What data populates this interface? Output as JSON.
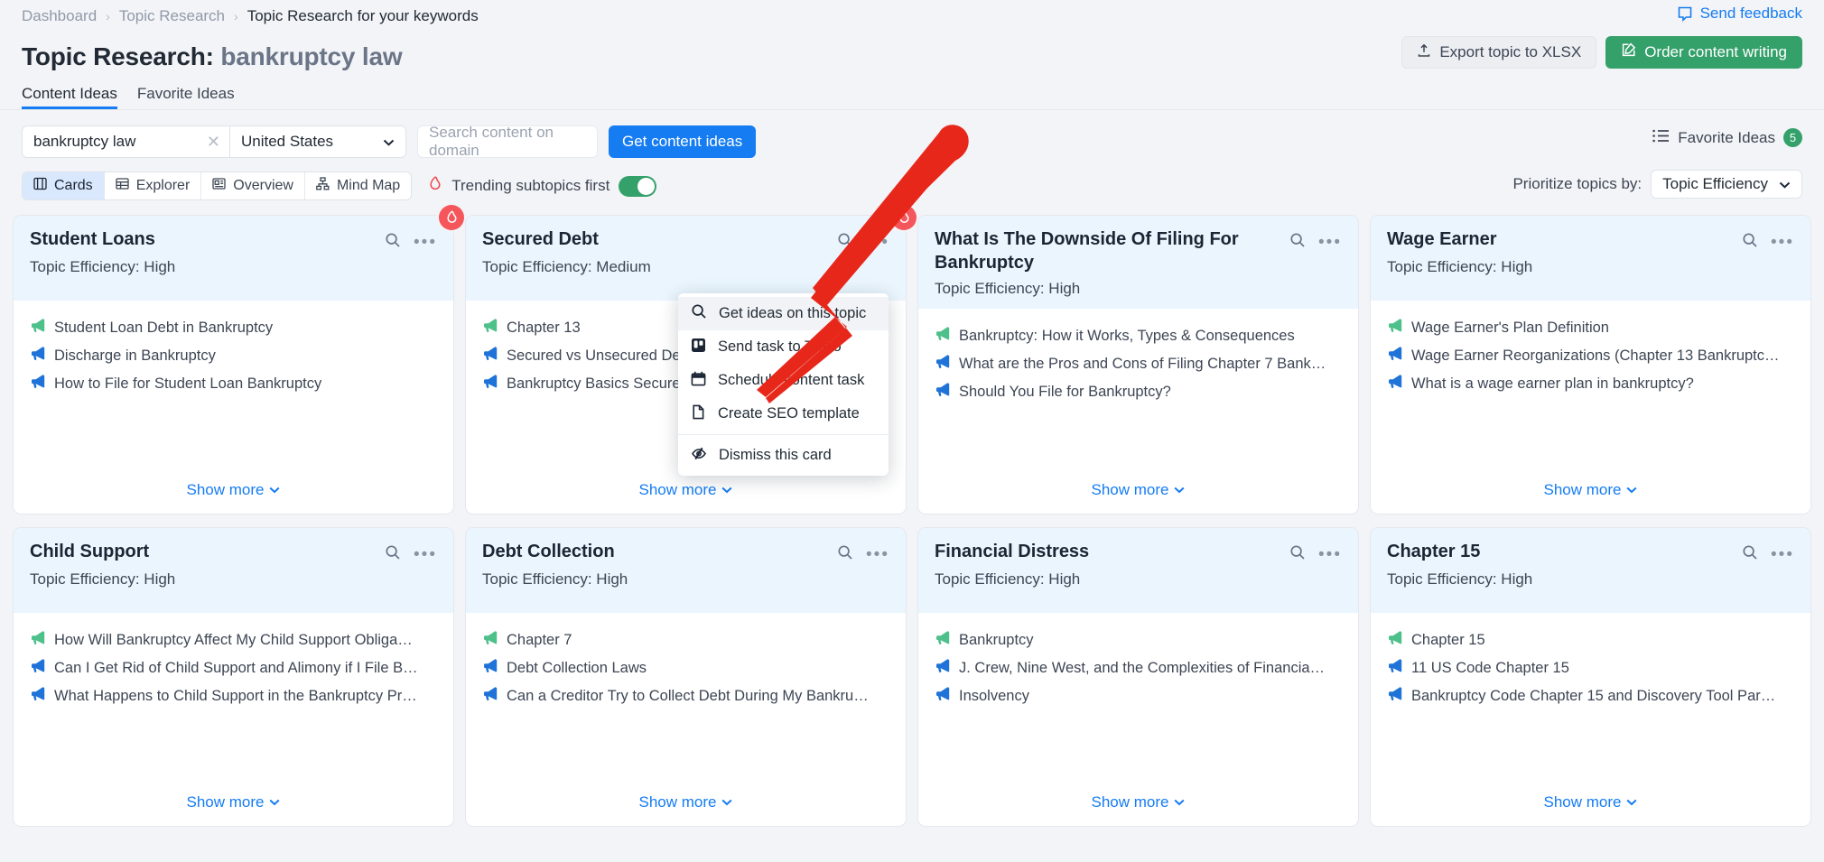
{
  "breadcrumb": {
    "items": [
      "Dashboard",
      "Topic Research",
      "Topic Research for your keywords"
    ],
    "separator": "›"
  },
  "header": {
    "feedback_label": "Send feedback",
    "title_prefix": "Topic Research:",
    "title_keyword": "bankruptcy law",
    "export_label": "Export topic to XLSX",
    "order_label": "Order content writing"
  },
  "tabs": [
    {
      "label": "Content Ideas",
      "active": true
    },
    {
      "label": "Favorite Ideas",
      "active": false
    }
  ],
  "search": {
    "keyword_value": "bankruptcy law",
    "clear_glyph": "✕",
    "country_value": "United States",
    "domain_placeholder": "Search content on domain",
    "get_ideas_label": "Get content ideas",
    "favorite_ideas_label": "Favorite Ideas",
    "favorite_ideas_count": "5"
  },
  "viewbar": {
    "views": [
      {
        "label": "Cards",
        "icon": "cards-icon",
        "active": true
      },
      {
        "label": "Explorer",
        "icon": "explorer-icon",
        "active": false
      },
      {
        "label": "Overview",
        "icon": "overview-icon",
        "active": false
      },
      {
        "label": "Mind Map",
        "icon": "mindmap-icon",
        "active": false
      }
    ],
    "trending_label": "Trending subtopics first",
    "trending_on": true,
    "prioritize_label": "Prioritize topics by:",
    "prioritize_value": "Topic Efficiency"
  },
  "context_menu": {
    "items": [
      {
        "label": "Get ideas on this topic",
        "icon": "search-icon",
        "hover": true
      },
      {
        "label": "Send task to Trello",
        "icon": "trello-icon",
        "hover": false
      },
      {
        "label": "Schedule content task",
        "icon": "calendar-icon",
        "hover": false
      },
      {
        "label": "Create SEO template",
        "icon": "document-icon",
        "hover": false
      },
      {
        "label": "Dismiss this card",
        "icon": "eye-off-icon",
        "hover": false
      }
    ]
  },
  "efficiency_prefix": "Topic Efficiency: ",
  "show_more_label": "Show more",
  "cards": [
    {
      "title": "Student Loans",
      "efficiency": "High",
      "trending": true,
      "ideas": [
        {
          "text": "Student Loan Debt in Bankruptcy",
          "color": "green"
        },
        {
          "text": "Discharge in Bankruptcy",
          "color": "blue"
        },
        {
          "text": "How to File for Student Loan Bankruptcy",
          "color": "blue"
        }
      ]
    },
    {
      "title": "Secured Debt",
      "efficiency": "Medium",
      "trending": true,
      "ideas": [
        {
          "text": "Chapter 13",
          "color": "green"
        },
        {
          "text": "Secured vs Unsecured Debt",
          "color": "blue"
        },
        {
          "text": "Bankruptcy Basics Secured Debt",
          "color": "blue"
        }
      ]
    },
    {
      "title": "What Is The Downside Of Filing For Bankruptcy",
      "efficiency": "High",
      "trending": false,
      "ideas": [
        {
          "text": "Bankruptcy: How it Works, Types & Consequences",
          "color": "green"
        },
        {
          "text": "What are the Pros and Cons of Filing Chapter 7 Bank…",
          "color": "blue"
        },
        {
          "text": "Should You File for Bankruptcy?",
          "color": "blue"
        }
      ]
    },
    {
      "title": "Wage Earner",
      "efficiency": "High",
      "trending": false,
      "ideas": [
        {
          "text": "Wage Earner's Plan Definition",
          "color": "green"
        },
        {
          "text": "Wage Earner Reorganizations (Chapter 13 Bankruptc…",
          "color": "blue"
        },
        {
          "text": "What is a wage earner plan in bankruptcy?",
          "color": "blue"
        }
      ]
    },
    {
      "title": "Child Support",
      "efficiency": "High",
      "trending": false,
      "ideas": [
        {
          "text": "How Will Bankruptcy Affect My Child Support Obliga…",
          "color": "green"
        },
        {
          "text": "Can I Get Rid of Child Support and Alimony if I File B…",
          "color": "blue"
        },
        {
          "text": "What Happens to Child Support in the Bankruptcy Pr…",
          "color": "blue"
        }
      ]
    },
    {
      "title": "Debt Collection",
      "efficiency": "High",
      "trending": false,
      "ideas": [
        {
          "text": "Chapter 7",
          "color": "green"
        },
        {
          "text": "Debt Collection Laws",
          "color": "blue"
        },
        {
          "text": "Can a Creditor Try to Collect Debt During My Bankru…",
          "color": "blue"
        }
      ]
    },
    {
      "title": "Financial Distress",
      "efficiency": "High",
      "trending": false,
      "ideas": [
        {
          "text": "Bankruptcy",
          "color": "green"
        },
        {
          "text": "J. Crew, Nine West, and the Complexities of Financia…",
          "color": "blue"
        },
        {
          "text": "Insolvency",
          "color": "blue"
        }
      ]
    },
    {
      "title": "Chapter 15",
      "efficiency": "High",
      "trending": false,
      "ideas": [
        {
          "text": "Chapter 15",
          "color": "green"
        },
        {
          "text": "11 US Code Chapter 15",
          "color": "blue"
        },
        {
          "text": "Bankruptcy Code Chapter 15 and Discovery Tool Par…",
          "color": "blue"
        }
      ]
    }
  ],
  "colors": {
    "accent_blue": "#157cf2",
    "accent_green": "#34a06a",
    "flame_red": "#f5565b",
    "annotation_red": "#e8271b",
    "card_head_bg": "#eaf5fd",
    "page_bg": "#f3f4f7"
  }
}
